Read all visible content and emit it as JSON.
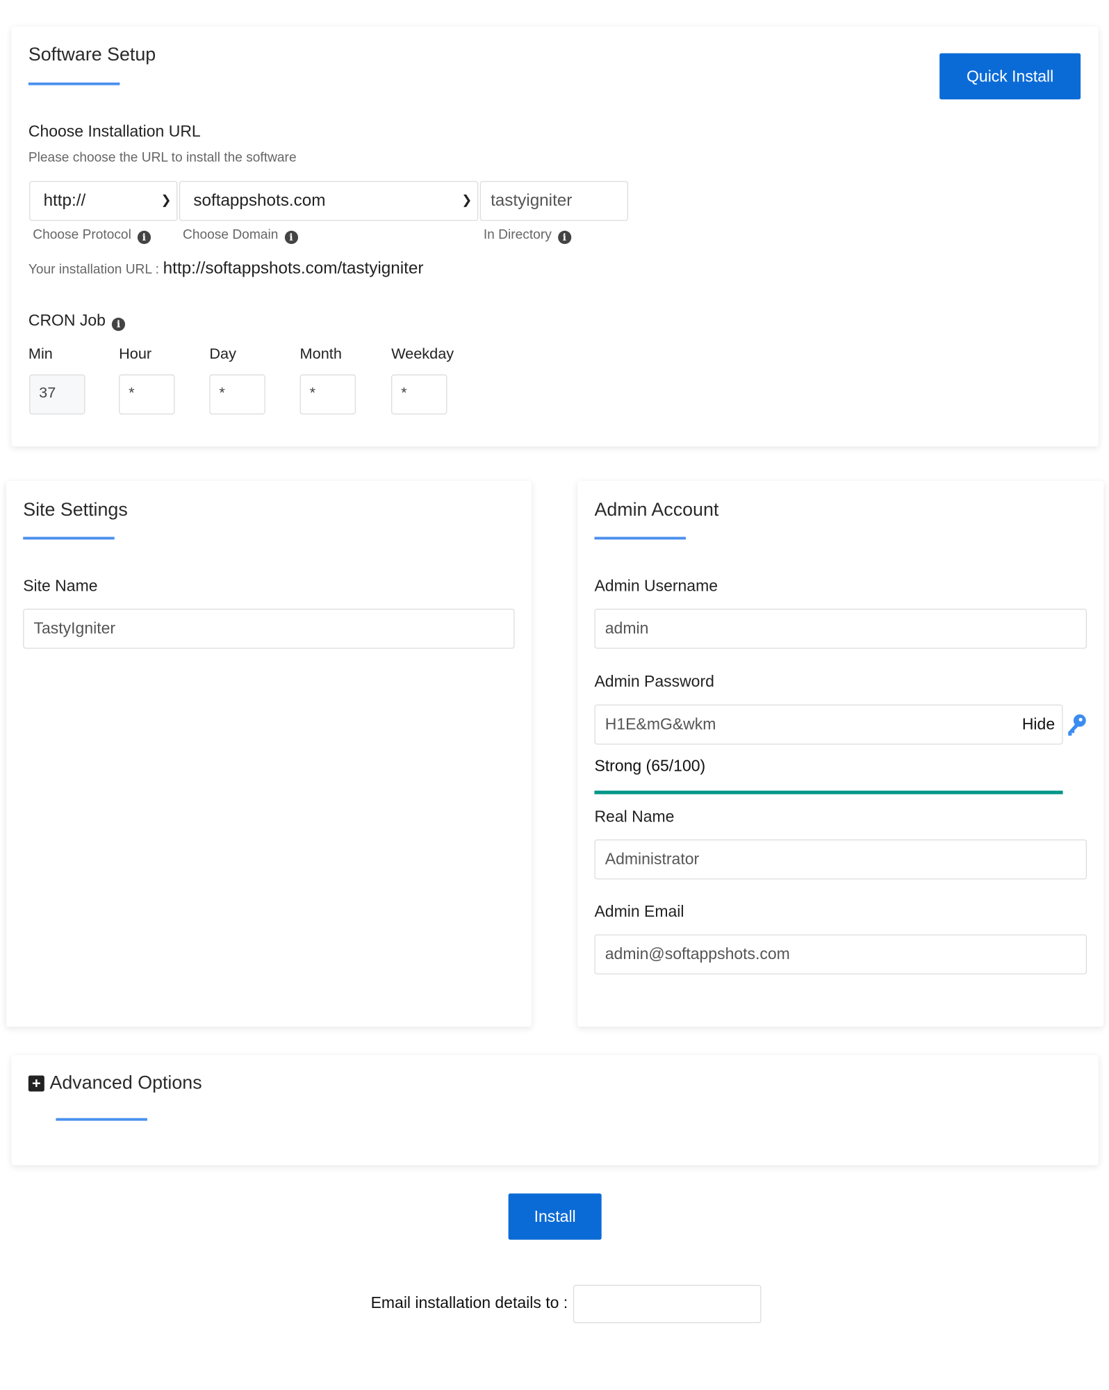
{
  "software_setup": {
    "title": "Software Setup",
    "quick_install": "Quick Install",
    "url_heading": "Choose Installation URL",
    "url_sub": "Please choose the URL to install the software",
    "protocol": "http://",
    "domain": "softappshots.com",
    "directory": "tastyigniter",
    "protocol_label": "Choose Protocol",
    "domain_label": "Choose Domain",
    "directory_label": "In Directory",
    "install_url_label": "Your installation URL :",
    "install_url": "http://softappshots.com/tastyigniter",
    "cron_title": "CRON Job",
    "cron": [
      {
        "label": "Min",
        "value": "37"
      },
      {
        "label": "Hour",
        "value": "*"
      },
      {
        "label": "Day",
        "value": "*"
      },
      {
        "label": "Month",
        "value": "*"
      },
      {
        "label": "Weekday",
        "value": "*"
      }
    ]
  },
  "site_settings": {
    "title": "Site Settings",
    "site_name_label": "Site Name",
    "site_name": "TastyIgniter"
  },
  "admin": {
    "title": "Admin Account",
    "username_label": "Admin Username",
    "username": "admin",
    "password_label": "Admin Password",
    "password": "H1E&mG&wkm",
    "hide": "Hide",
    "strength": "Strong (65/100)",
    "strength_value": 65,
    "real_name_label": "Real Name",
    "real_name": "Administrator",
    "email_label": "Admin Email",
    "email": "admin@softappshots.com"
  },
  "advanced": {
    "title": "Advanced Options"
  },
  "install": "Install",
  "email_details_label": "Email installation details to :",
  "email_details": "",
  "colors": {
    "accent": "#0b6bd6",
    "underline": "#4a8fef",
    "strength": "#009688"
  }
}
